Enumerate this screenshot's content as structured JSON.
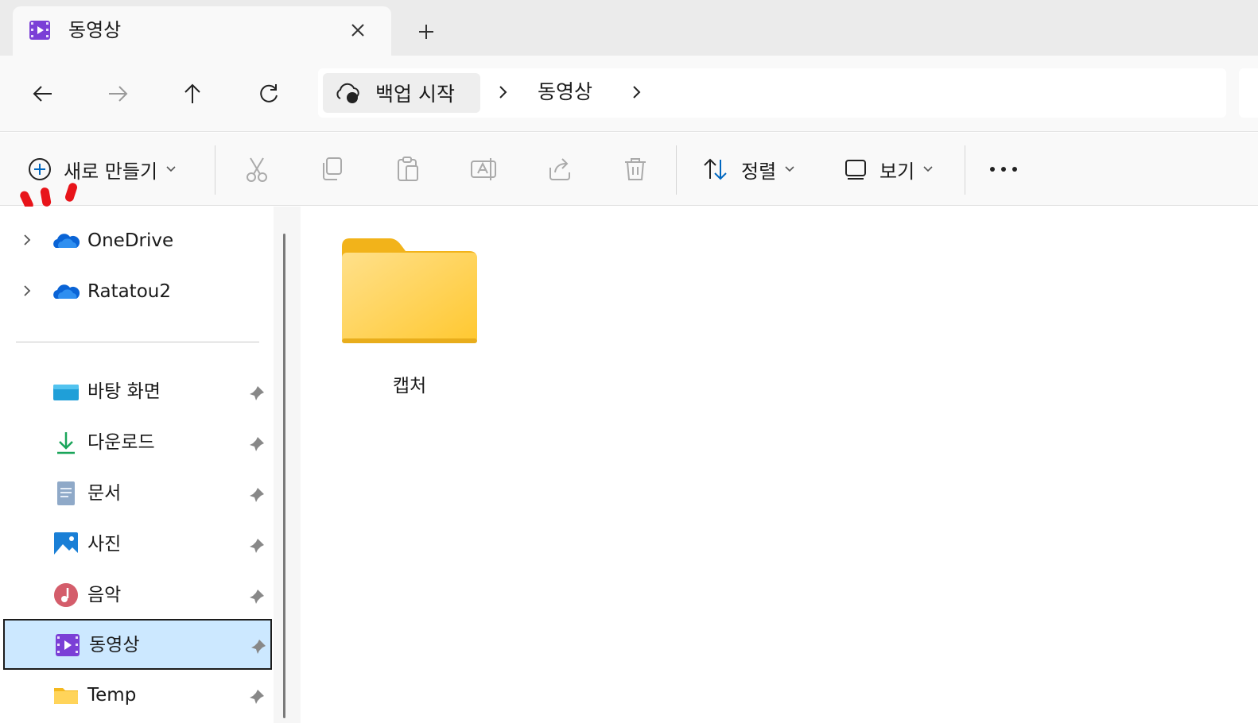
{
  "tab": {
    "title": "동영상",
    "close_icon": "close-icon",
    "new_tab_icon": "plus-icon"
  },
  "nav": {
    "back": "arrow-left-icon",
    "forward": "arrow-right-icon",
    "up": "arrow-up-icon",
    "refresh": "refresh-icon"
  },
  "address": {
    "backup_label": "백업 시작",
    "crumbs": [
      "동영상"
    ]
  },
  "toolbar": {
    "new_label": "새로 만들기",
    "sort_label": "정렬",
    "view_label": "보기",
    "more_label": "···"
  },
  "sidebar": {
    "cloud": [
      {
        "label": "OneDrive"
      },
      {
        "label": "Ratatou2"
      }
    ],
    "pinned": [
      {
        "label": "바탕 화면",
        "icon": "desktop-icon"
      },
      {
        "label": "다운로드",
        "icon": "download-icon"
      },
      {
        "label": "문서",
        "icon": "documents-icon"
      },
      {
        "label": "사진",
        "icon": "pictures-icon"
      },
      {
        "label": "음악",
        "icon": "music-icon"
      },
      {
        "label": "동영상",
        "icon": "videos-icon",
        "selected": true
      },
      {
        "label": "Temp",
        "icon": "folder-icon"
      }
    ]
  },
  "content": {
    "items": [
      {
        "label": "캡처",
        "type": "folder"
      }
    ]
  },
  "colors": {
    "accent": "#0067c0",
    "selection": "#cce8ff",
    "folder": "#ffcf48",
    "annotation": "#e8141a"
  }
}
